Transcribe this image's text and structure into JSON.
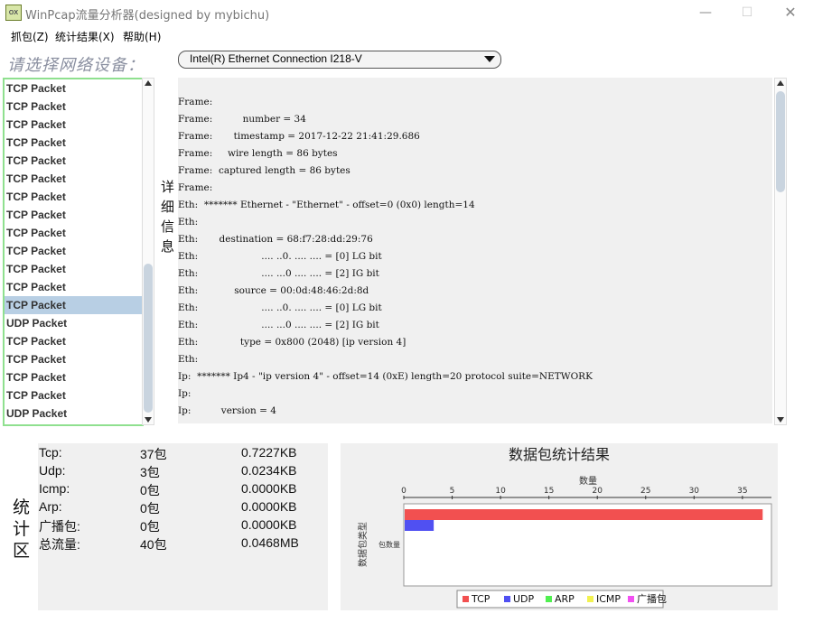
{
  "window": {
    "title": "WinPcap流量分析器(designed by mybichu)",
    "icon_text": "ox"
  },
  "menu": [
    "抓包(Z)",
    "统计结果(X)",
    "帮助(H)"
  ],
  "device": {
    "label": "请选择网络设备：",
    "selected": "Intel(R) Ethernet Connection I218-V"
  },
  "packets": [
    "TCP Packet",
    "TCP Packet",
    "TCP Packet",
    "TCP Packet",
    "TCP Packet",
    "TCP Packet",
    "TCP Packet",
    "TCP Packet",
    "TCP Packet",
    "TCP Packet",
    "TCP Packet",
    "TCP Packet",
    "TCP Packet",
    "UDP Packet",
    "TCP Packet",
    "TCP Packet",
    "TCP Packet",
    "TCP Packet",
    "UDP Packet"
  ],
  "selected_packet_index": 12,
  "detail": {
    "label": "详细信息",
    "lines": [
      "Frame:",
      "Frame:          number = 34",
      "Frame:       timestamp = 2017-12-22 21:41:29.686",
      "Frame:     wire length = 86 bytes",
      "Frame:  captured length = 86 bytes",
      "Frame:",
      "Eth:  ******* Ethernet - \"Ethernet\" - offset=0 (0x0) length=14",
      "Eth:",
      "Eth:       destination = 68:f7:28:dd:29:76",
      "Eth:                     .... ..0. .... .... = [0] LG bit",
      "Eth:                     .... ...0 .... .... = [2] IG bit",
      "Eth:            source = 00:0d:48:46:2d:8d",
      "Eth:                     .... ..0. .... .... = [0] LG bit",
      "Eth:                     .... ...0 .... .... = [2] IG bit",
      "Eth:              type = 0x800 (2048) [ip version 4]",
      "Eth:",
      "Ip:  ******* Ip4 - \"ip version 4\" - offset=14 (0xE) length=20 protocol suite=NETWORK",
      "Ip:",
      "Ip:          version = 4"
    ]
  },
  "stats": {
    "label": "统计区",
    "rows": [
      {
        "name": "Tcp:",
        "count": "37包",
        "size": "0.7227KB"
      },
      {
        "name": "Udp:",
        "count": "3包",
        "size": "0.0234KB"
      },
      {
        "name": "Icmp:",
        "count": "0包",
        "size": "0.0000KB"
      },
      {
        "name": "Arp:",
        "count": "0包",
        "size": "0.0000KB"
      },
      {
        "name": "广播包:",
        "count": "0包",
        "size": "0.0000KB"
      },
      {
        "name": "总流量:",
        "count": "40包",
        "size": "0.0468MB"
      }
    ]
  },
  "chart_data": {
    "type": "bar",
    "orientation": "horizontal",
    "title": "数据包统计结果",
    "xlabel": "数量",
    "ylabel": "数据包类型",
    "categories": [
      "包数量"
    ],
    "xlim": [
      0,
      38
    ],
    "xticks": [
      0,
      5,
      10,
      15,
      20,
      25,
      30,
      35
    ],
    "series": [
      {
        "name": "TCP",
        "values": [
          37
        ],
        "color": "#f25050"
      },
      {
        "name": "UDP",
        "values": [
          3
        ],
        "color": "#5050f2"
      },
      {
        "name": "ARP",
        "values": [
          0
        ],
        "color": "#50f050"
      },
      {
        "name": "ICMP",
        "values": [
          0
        ],
        "color": "#f2f250"
      },
      {
        "name": "广播包",
        "values": [
          0
        ],
        "color": "#f250f2"
      }
    ],
    "legend": "bottom"
  }
}
